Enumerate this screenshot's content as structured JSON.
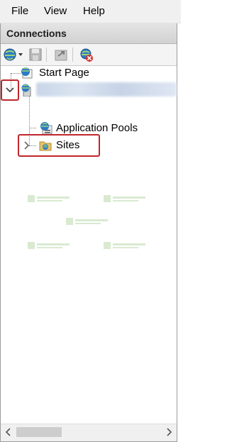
{
  "menubar": {
    "items": [
      "File",
      "View",
      "Help"
    ]
  },
  "panel": {
    "title": "Connections"
  },
  "toolbar": {
    "buttons": [
      "connect-globe-icon",
      "save-icon",
      "export-icon",
      "disconnect-icon"
    ]
  },
  "tree": {
    "start_page": "Start Page",
    "server_name": "",
    "application_pools": "Application Pools",
    "sites": "Sites"
  },
  "colors": {
    "highlight": "#c0262d",
    "panel_header": "#d9d9d9",
    "menubar": "#f0f0f0"
  }
}
